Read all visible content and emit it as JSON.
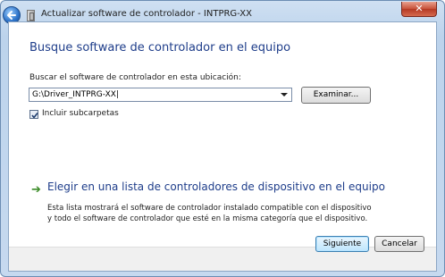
{
  "window": {
    "title": "Actualizar software de controlador - INTPRG-XX",
    "close_glyph": "✕",
    "icons": [
      "back-arrow-icon",
      "driver-icon",
      "close-icon"
    ]
  },
  "main": {
    "heading": "Busque software de controlador en el equipo",
    "search_label": "Buscar el software de controlador en esta ubicación:",
    "path_value": "G:\\Driver_INTPRG-XX|",
    "browse_button": "Examinar...",
    "include_subfolders_label": "Incluir subcarpetas",
    "include_subfolders_checked": true,
    "choose_link_arrow": "➔",
    "choose_link": "Elegir en una lista de controladores de dispositivo en el equipo",
    "choose_desc_line1": "Esta lista mostrará el software de controlador instalado compatible con el dispositivo",
    "choose_desc_line2": "y todo el software de controlador que esté en la misma categoría que el dispositivo."
  },
  "footer": {
    "next_button": "Siguiente",
    "cancel_button": "Cancelar"
  },
  "colors": {
    "heading": "#1e3d8a",
    "link_arrow": "#3a8a26",
    "close_button": "#c75038"
  }
}
